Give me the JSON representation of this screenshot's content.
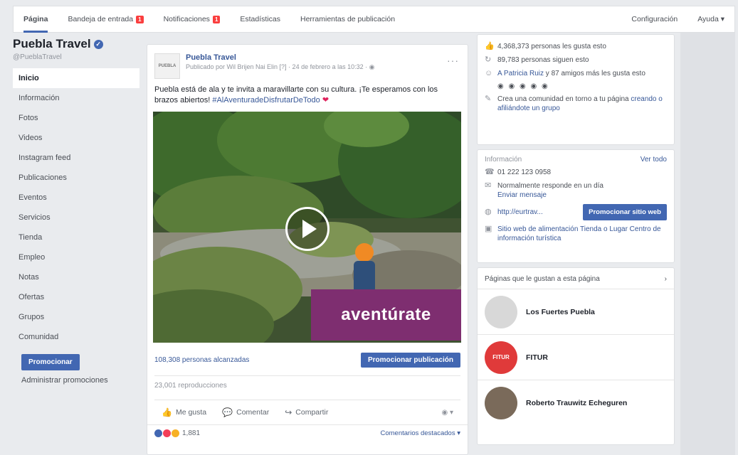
{
  "nav": {
    "tabs": [
      {
        "label": "Página"
      },
      {
        "label": "Bandeja de entrada",
        "badge": "1"
      },
      {
        "label": "Notificaciones",
        "badge": "1"
      },
      {
        "label": "Estadísticas"
      },
      {
        "label": "Herramientas de publicación"
      }
    ],
    "settings": "Configuración",
    "help": "Ayuda ▾"
  },
  "sidebar": {
    "page_name": "Puebla Travel",
    "handle": "@PueblaTravel",
    "items": [
      "Inicio",
      "Información",
      "Fotos",
      "Videos",
      "Instagram feed",
      "Publicaciones",
      "Eventos",
      "Servicios",
      "Tienda",
      "Empleo",
      "Notas",
      "Ofertas",
      "Grupos",
      "Comunidad"
    ],
    "promote": "Promocionar",
    "manage_promotions": "Administrar promociones"
  },
  "post": {
    "avatar_text": "PUEBLA",
    "author": "Puebla Travel",
    "time": "Publicado por Wil Brijen Nai Elin [?] · 24 de febrero a las 10:32 · ◉",
    "text": "Puebla está de ala y te invita a maravillarte con su cultura. ¡Te esperamos con los brazos abiertos!",
    "hashtag": "#AlAventuradeDisfrutarDeTodo",
    "heart": "❤",
    "video_overlay": "aventúrate",
    "reach": "108,308 personas alcanzadas",
    "boost": "Promocionar publicación",
    "engagement": "23,001 reproducciones",
    "actions": {
      "like": "Me gusta",
      "comment": "Comentar",
      "share": "Compartir",
      "audience": "◉ ▾"
    },
    "reactions_count": "1,881",
    "comment_filter": "Comentarios destacados ▾"
  },
  "about": {
    "lines": [
      {
        "icon": "👍",
        "text": "4,368,373 personas les gusta esto"
      },
      {
        "icon": "↻",
        "text": "89,783 personas siguen esto"
      },
      {
        "icon": "☺",
        "text_link": "A Patricia Ruiz",
        "text": " y 87 amigos más les gusta esto"
      },
      {
        "icon": "✎",
        "text": "Crea una comunidad en torno a tu página ",
        "text_link2": "creando o afiliándote un grupo"
      }
    ],
    "avatars": "◉ ◉ ◉ ◉ ◉"
  },
  "info": {
    "title": "Información",
    "see_all": "Ver todo",
    "phone": "01 222 123 0958",
    "response": "Normalmente responde en un día",
    "send_message": "Enviar mensaje",
    "web": "http://eurtrav...",
    "promote_web": "Promocionar sitio web",
    "category": "Sitio web de alimentación Tienda o Lugar Centro de información turística"
  },
  "liked": {
    "title": "Páginas que le gustan a esta página",
    "arrow": "›",
    "pages": [
      {
        "name": "Los Fuertes Puebla",
        "av_text": "",
        "color": "#d8d8d8"
      },
      {
        "name": "FITUR",
        "av_text": "FITUR",
        "color": "#e03a3a"
      },
      {
        "name": "Roberto Trauwitz Echeguren",
        "av_text": "",
        "color": "#7a6a5a"
      }
    ]
  }
}
